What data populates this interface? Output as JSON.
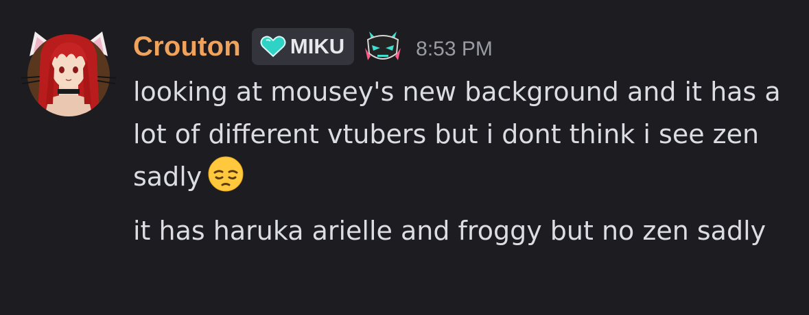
{
  "message": {
    "author": {
      "name": "Crouton",
      "name_color": "#f0a35c",
      "avatar": "avatar-image",
      "tag": {
        "icon": "heart-icon",
        "label": "MIKU"
      },
      "badge": "mask-badge-icon"
    },
    "timestamp": "8:53 PM",
    "lines": [
      {
        "text": "looking at mousey's new background and it has a lot of different vtubers but i dont think i see zen sadly",
        "emoji": "pensive-emoji"
      },
      {
        "text": "it has haruka arielle and froggy but no zen sadly"
      }
    ]
  }
}
